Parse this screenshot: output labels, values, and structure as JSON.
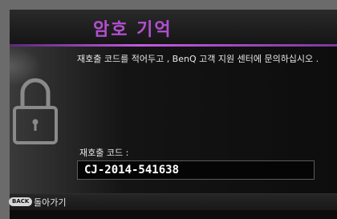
{
  "dialog": {
    "title": "암호 기억",
    "message": "재호출 코드를 적어두고 , BenQ 고객 지원 센터에 문의하십시오 .",
    "code_label": "재호출 코드 :",
    "code_value": "CJ-2014-541638"
  },
  "footer": {
    "back_key": "BACK",
    "back_label": "돌아가기"
  },
  "colors": {
    "title": "#b34fd0",
    "accent": "#c25ae0",
    "background": "#0c0c0c"
  },
  "icons": {
    "lock": "padlock-icon"
  }
}
